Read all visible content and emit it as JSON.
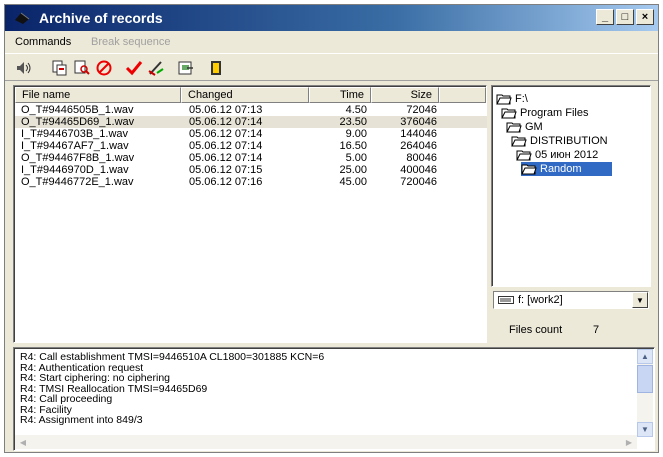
{
  "window": {
    "title": "Archive of records",
    "controls": [
      "_",
      "□",
      "×"
    ]
  },
  "menu": {
    "commands": "Commands",
    "break_sequence": "Break sequence"
  },
  "toolbar": {
    "icons": [
      "speaker-icon",
      "copy-record-icon",
      "find-icon",
      "stop-icon",
      "checkmark-icon",
      "edit-icon",
      "export-icon",
      "exit-icon"
    ]
  },
  "file_table": {
    "columns": {
      "name": "File name",
      "changed": "Changed",
      "time": "Time",
      "size": "Size"
    },
    "selected_index": 1,
    "rows": [
      {
        "name": "O_T#9446505B_1.wav",
        "changed": "05.06.12 07:13",
        "time": "4.50",
        "size": "72046"
      },
      {
        "name": "O_T#94465D69_1.wav",
        "changed": "05.06.12 07:14",
        "time": "23.50",
        "size": "376046"
      },
      {
        "name": "I_T#9446703B_1.wav",
        "changed": "05.06.12 07:14",
        "time": "9.00",
        "size": "144046"
      },
      {
        "name": "I_T#94467AF7_1.wav",
        "changed": "05.06.12 07:14",
        "time": "16.50",
        "size": "264046"
      },
      {
        "name": "O_T#94467F8B_1.wav",
        "changed": "05.06.12 07:14",
        "time": "5.00",
        "size": "80046"
      },
      {
        "name": "I_T#9446970D_1.wav",
        "changed": "05.06.12 07:15",
        "time": "25.00",
        "size": "400046"
      },
      {
        "name": "O_T#9446772E_1.wav",
        "changed": "05.06.12 07:16",
        "time": "45.00",
        "size": "720046"
      }
    ]
  },
  "folder_tree": {
    "nodes": [
      {
        "label": "F:\\",
        "depth": 0,
        "selected": false
      },
      {
        "label": "Program Files",
        "depth": 1,
        "selected": false
      },
      {
        "label": "GM",
        "depth": 2,
        "selected": false
      },
      {
        "label": "DISTRIBUTION",
        "depth": 3,
        "selected": false
      },
      {
        "label": "05 июн 2012",
        "depth": 4,
        "selected": false
      },
      {
        "label": "Random",
        "depth": 5,
        "selected": true
      }
    ]
  },
  "drive_select": {
    "value": "f: [work2]"
  },
  "files_count": {
    "label": "Files count",
    "value": "7"
  },
  "log": {
    "lines": [
      "R4: Call establishment TMSI=9446510A CL1800=301885 KCN=6",
      "R4: Authentication request",
      "R4: Start ciphering: no ciphering",
      "R4: TMSI Reallocation  TMSI=94465D69",
      "R4: Call proceeding",
      "R4: Facility",
      "R4: Assignment into 849/3"
    ]
  },
  "colors": {
    "title_start": "#0a246a",
    "title_end": "#a6caf0",
    "selection": "#316ac5",
    "face": "#ece9d8"
  }
}
